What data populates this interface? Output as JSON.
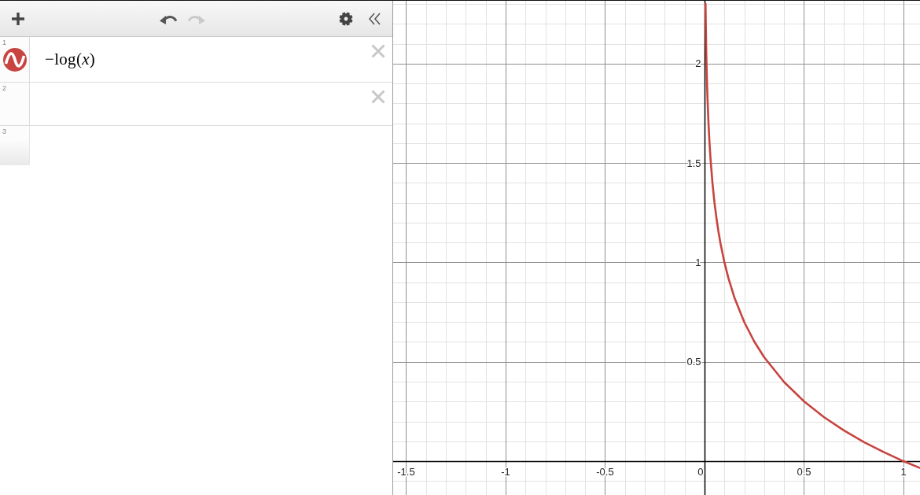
{
  "toolbar": {
    "buttons": [
      {
        "kind": "add",
        "disabled": false
      },
      {
        "kind": "undo",
        "disabled": false
      },
      {
        "kind": "redo",
        "disabled": true
      },
      {
        "kind": "settings",
        "disabled": false
      },
      {
        "kind": "collapse",
        "disabled": false
      }
    ]
  },
  "expressions": [
    {
      "kind": "expression",
      "number": "1",
      "text": "−log(*x*)",
      "color": "#c74440",
      "visible": true
    },
    {
      "kind": "empty",
      "number": "2"
    },
    {
      "kind": "new",
      "number": "3"
    }
  ],
  "graph": {
    "chart_data": {
      "type": "line",
      "x": [
        0.005,
        0.006,
        0.008,
        0.01,
        0.013,
        0.016,
        0.02,
        0.025,
        0.03,
        0.04,
        0.05,
        0.06,
        0.07,
        0.08,
        0.1,
        0.12,
        0.15,
        0.2,
        0.25,
        0.3,
        0.4,
        0.5,
        0.6,
        0.7,
        0.8,
        0.9,
        1,
        1.08
      ],
      "series": [
        {
          "color": "#c74440",
          "values": [
            2.301,
            2.222,
            2.097,
            2,
            1.886,
            1.796,
            1.699,
            1.602,
            1.523,
            1.398,
            1.301,
            1.222,
            1.155,
            1.097,
            1,
            0.921,
            0.824,
            0.699,
            0.602,
            0.523,
            0.398,
            0.301,
            0.222,
            0.155,
            0.097,
            0.046,
            0,
            -0.033
          ]
        }
      ],
      "xlim": [
        -1.565,
        1.083
      ],
      "ylim": [
        -0.17,
        2.316
      ],
      "xticks": [
        -1.5,
        -1,
        -0.5,
        0,
        0.5,
        1
      ],
      "yticks": [
        0.5,
        1,
        1.5,
        2
      ],
      "grid": true
    }
  }
}
